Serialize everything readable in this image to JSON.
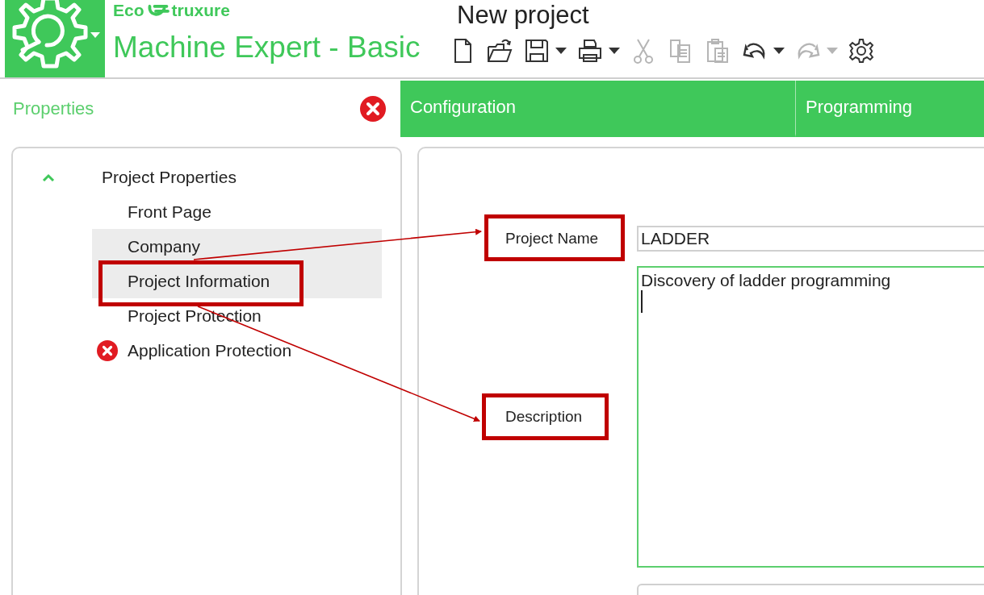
{
  "app": {
    "logo_text": [
      "Eco",
      "truxure"
    ],
    "product": "Machine Expert - Basic",
    "title": "New project"
  },
  "toolbar": [
    {
      "kind": "new",
      "disabled": false,
      "dropdown": false
    },
    {
      "kind": "open",
      "disabled": false,
      "dropdown": false
    },
    {
      "kind": "save",
      "disabled": false,
      "dropdown": true
    },
    {
      "kind": "print",
      "disabled": false,
      "dropdown": true
    },
    {
      "kind": "cut",
      "disabled": true,
      "dropdown": false
    },
    {
      "kind": "copy",
      "disabled": true,
      "dropdown": false
    },
    {
      "kind": "paste",
      "disabled": true,
      "dropdown": false
    },
    {
      "kind": "undo",
      "disabled": false,
      "dropdown": true
    },
    {
      "kind": "redo",
      "disabled": true,
      "dropdown": true
    },
    {
      "kind": "settings",
      "disabled": false,
      "dropdown": false
    }
  ],
  "properties_header": {
    "title": "Properties",
    "error": true
  },
  "tabs": [
    {
      "label": "Configuration",
      "selected": false
    },
    {
      "label": "Programming",
      "selected": false
    }
  ],
  "tree": [
    {
      "label": "Project Properties",
      "expanded": true,
      "children": [
        {
          "label": "Front Page",
          "selected": false,
          "error": false
        },
        {
          "label": "Company",
          "selected": true,
          "error": false
        },
        {
          "label": "Project Information",
          "selected": true,
          "error": false
        },
        {
          "label": "Project Protection",
          "selected": false,
          "error": false
        },
        {
          "label": "Application Protection",
          "selected": false,
          "error": true
        }
      ]
    }
  ],
  "form": {
    "fields": [
      {
        "kind": "input",
        "label": "Project Name",
        "value": "LADDER",
        "focused": false
      },
      {
        "kind": "textarea",
        "label": "Description",
        "value": "Discovery of ladder programming",
        "focused": true
      },
      {
        "kind": "input",
        "focused": false
      }
    ]
  }
}
